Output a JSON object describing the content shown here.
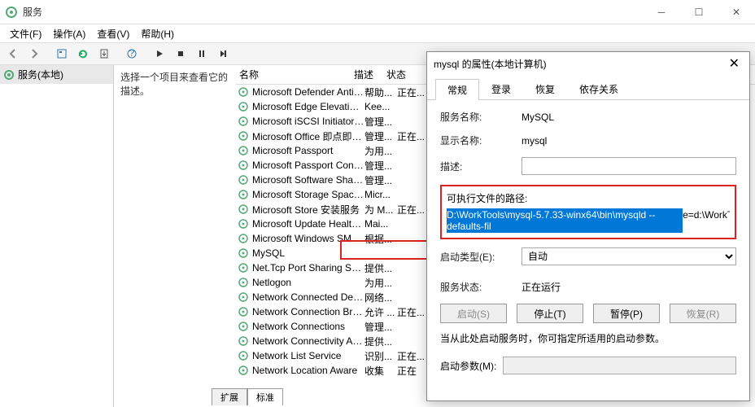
{
  "titlebar": {
    "title": "服务"
  },
  "menubar": {
    "file": "文件(F)",
    "action": "操作(A)",
    "view": "查看(V)",
    "help": "帮助(H)"
  },
  "tree": {
    "root": "服务(本地)"
  },
  "mainpanel": {
    "instruction": "选择一个项目来查看它的描述。",
    "col_name": "名称",
    "col_desc": "描述",
    "col_status": "状态"
  },
  "services": [
    {
      "name": "Microsoft Defender Antiv...",
      "desc": "帮助...",
      "status": "正在..."
    },
    {
      "name": "Microsoft Edge Elevation...",
      "desc": "Kee...",
      "status": ""
    },
    {
      "name": "Microsoft iSCSI Initiator ...",
      "desc": "管理...",
      "status": ""
    },
    {
      "name": "Microsoft Office 即点即用...",
      "desc": "管理...",
      "status": "正在..."
    },
    {
      "name": "Microsoft Passport",
      "desc": "为用...",
      "status": ""
    },
    {
      "name": "Microsoft Passport Cont...",
      "desc": "管理...",
      "status": ""
    },
    {
      "name": "Microsoft Software Shad...",
      "desc": "管理...",
      "status": ""
    },
    {
      "name": "Microsoft Storage Space...",
      "desc": "Micr...",
      "status": ""
    },
    {
      "name": "Microsoft Store 安装服务",
      "desc": "为 M...",
      "status": "正在..."
    },
    {
      "name": "Microsoft Update Health...",
      "desc": "Mai...",
      "status": ""
    },
    {
      "name": "Microsoft Windows SMS ...",
      "desc": "根据...",
      "status": ""
    },
    {
      "name": "MySQL",
      "desc": "",
      "status": ""
    },
    {
      "name": "Net.Tcp Port Sharing Ser...",
      "desc": "提供...",
      "status": ""
    },
    {
      "name": "Netlogon",
      "desc": "为用...",
      "status": ""
    },
    {
      "name": "Network Connected Devi...",
      "desc": "网络...",
      "status": ""
    },
    {
      "name": "Network Connection Bro...",
      "desc": "允许 ...",
      "status": "正在..."
    },
    {
      "name": "Network Connections",
      "desc": "管理...",
      "status": ""
    },
    {
      "name": "Network Connectivity Ass...",
      "desc": "提供...",
      "status": ""
    },
    {
      "name": "Network List Service",
      "desc": "识别...",
      "status": "正在..."
    },
    {
      "name": "Network Location Aware",
      "desc": "收集",
      "status": "正在"
    }
  ],
  "bottom_tabs": {
    "extended": "扩展",
    "standard": "标准"
  },
  "dlg": {
    "title": "mysql 的属性(本地计算机)",
    "tabs": {
      "general": "常规",
      "logon": "登录",
      "recovery": "恢复",
      "deps": "依存关系"
    },
    "svc_name_lbl": "服务名称:",
    "svc_name_val": "MySQL",
    "disp_name_lbl": "显示名称:",
    "disp_name_val": "mysql",
    "desc_lbl": "描述:",
    "desc_val": "",
    "exec_lbl": "可执行文件的路径:",
    "exec_sel": "D:\\WorkTools\\mysql-5.7.33-winx64\\bin\\mysqld --defaults-fil",
    "exec_rest": "e=d:\\WorkT",
    "startup_lbl": "启动类型(E):",
    "startup_val": "自动",
    "state_lbl": "服务状态:",
    "state_val": "正在运行",
    "btn_start": "启动(S)",
    "btn_stop": "停止(T)",
    "btn_pause": "暂停(P)",
    "btn_resume": "恢复(R)",
    "note": "当从此处启动服务时，你可指定所适用的启动参数。",
    "params_lbl": "启动参数(M):"
  }
}
